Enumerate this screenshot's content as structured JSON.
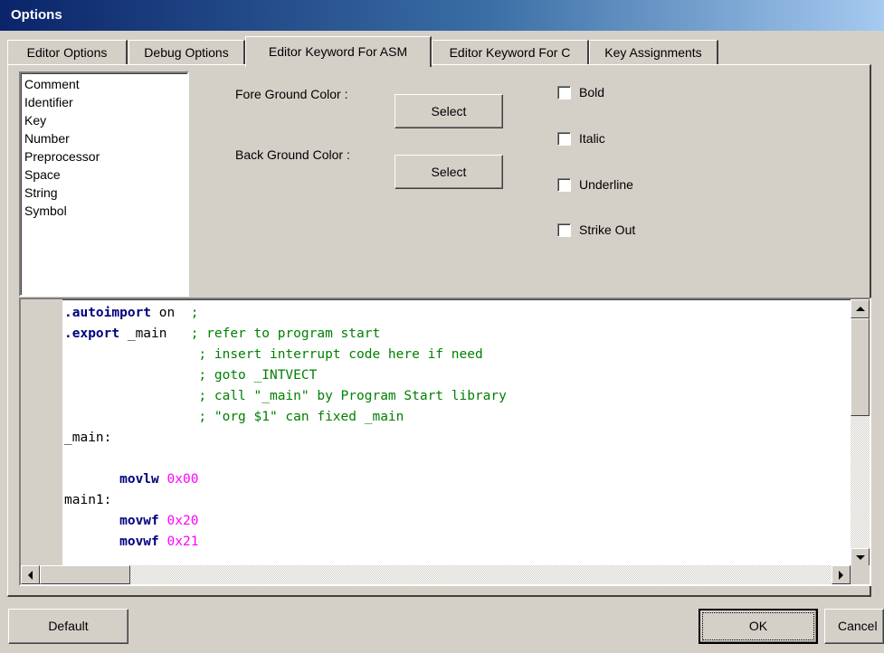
{
  "window": {
    "title": "Options"
  },
  "tabs": [
    {
      "label": "Editor Options",
      "active": false
    },
    {
      "label": "Debug Options",
      "active": false
    },
    {
      "label": "Editor Keyword For ASM",
      "active": true
    },
    {
      "label": "Editor Keyword For C",
      "active": false
    },
    {
      "label": "Key Assignments",
      "active": false
    }
  ],
  "keyword_list": {
    "items": [
      "Comment",
      "Identifier",
      "Key",
      "Number",
      "Preprocessor",
      "Space",
      "String",
      "Symbol"
    ]
  },
  "colors_section": {
    "fore_label": "Fore Ground Color :",
    "back_label": "Back Ground Color :",
    "fore_button": "Select",
    "back_button": "Select"
  },
  "styles": {
    "bold": {
      "label": "Bold",
      "checked": false
    },
    "italic": {
      "label": "Italic",
      "checked": false
    },
    "underline": {
      "label": "Underline",
      "checked": false
    },
    "strikeout": {
      "label": "Strike Out",
      "checked": false
    }
  },
  "editor": {
    "lines": [
      {
        "indent": "",
        "kw": ".autoimport",
        "mid": " on  ",
        "num": "",
        "comment": ";"
      },
      {
        "indent": "",
        "kw": ".export",
        "mid": " _main   ",
        "num": "",
        "comment": "; refer to program start"
      },
      {
        "indent": "                 ",
        "kw": "",
        "mid": "",
        "num": "",
        "comment": "; insert interrupt code here if need"
      },
      {
        "indent": "                 ",
        "kw": "",
        "mid": "",
        "num": "",
        "comment": "; goto _INTVECT"
      },
      {
        "indent": "                 ",
        "kw": "",
        "mid": "",
        "num": "",
        "comment": "; call \"_main\" by Program Start library"
      },
      {
        "indent": "                 ",
        "kw": "",
        "mid": "",
        "num": "",
        "comment": "; \"org $1\" can fixed _main"
      },
      {
        "indent": "",
        "kw": "",
        "mid": "_main:",
        "num": "",
        "comment": ""
      },
      {
        "indent": "",
        "kw": "",
        "mid": "",
        "num": "",
        "comment": ""
      },
      {
        "indent": "       ",
        "kw": "movlw",
        "mid": " ",
        "num": "0x00",
        "comment": ""
      },
      {
        "indent": "",
        "kw": "",
        "mid": "main1:",
        "num": "",
        "comment": ""
      },
      {
        "indent": "       ",
        "kw": "movwf",
        "mid": " ",
        "num": "0x20",
        "comment": ""
      },
      {
        "indent": "       ",
        "kw": "movwf",
        "mid": " ",
        "num": "0x21",
        "comment": ""
      }
    ],
    "colors": {
      "keyword": "#000080",
      "comment": "#008000",
      "number": "#ff00ff"
    }
  },
  "footer": {
    "default_button": "Default",
    "ok_button": "OK",
    "cancel_button": "Cancel"
  }
}
